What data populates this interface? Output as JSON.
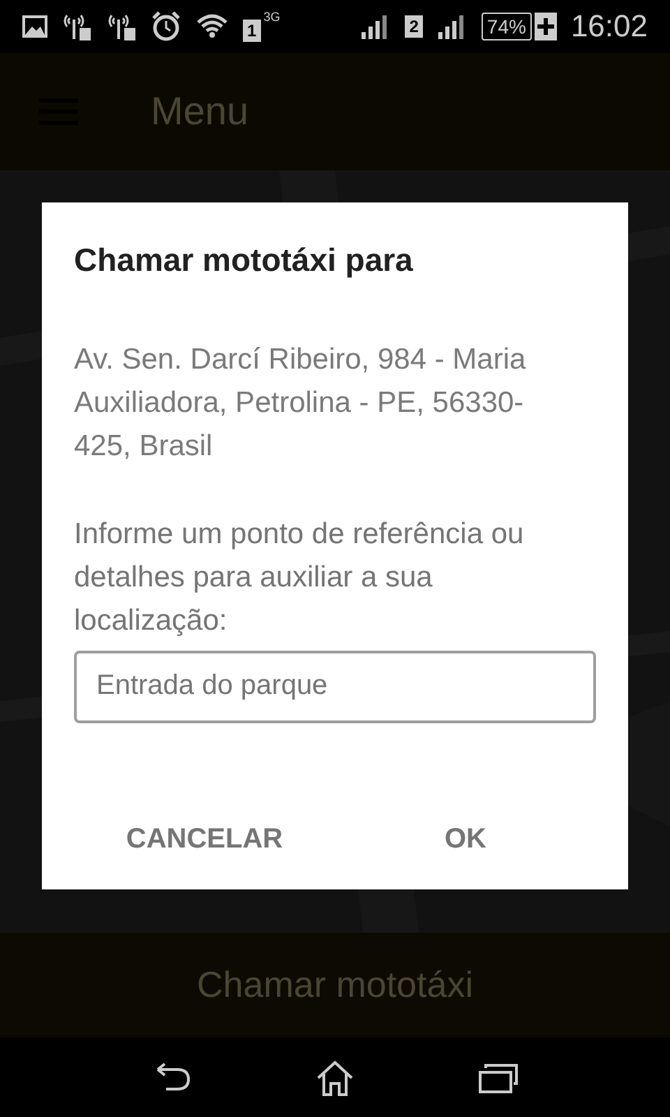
{
  "status_bar": {
    "sim1_label": "1",
    "network": "3G",
    "sim2_label": "2",
    "battery": "74%",
    "time": "16:02"
  },
  "app_bar": {
    "title": "Menu"
  },
  "main_button": {
    "label": "Chamar mototáxi"
  },
  "dialog": {
    "title": "Chamar mototáxi para",
    "address": "Av. Sen. Darcí Ribeiro, 984 - Maria Auxiliadora, Petrolina - PE, 56330-425, Brasil",
    "prompt": "Informe um ponto de referência ou detalhes para auxiliar a sua localização:",
    "field": {
      "value": "Entrada do parque"
    },
    "buttons": [
      "CANCELAR",
      "OK"
    ]
  }
}
